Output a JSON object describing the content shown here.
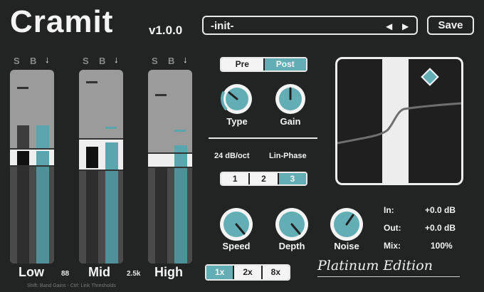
{
  "header": {
    "title": "Cramit",
    "version": "v1.0.0",
    "save_label": "Save"
  },
  "preset": {
    "name": "-init-"
  },
  "bands": {
    "solo_label": "S",
    "bypass_label": "B",
    "items": [
      {
        "label": "Low",
        "crossover": "88"
      },
      {
        "label": "Mid",
        "crossover": "2.5k"
      },
      {
        "label": "High",
        "crossover": ""
      }
    ]
  },
  "hint": "Shift: Band Gains - Ctrl: Link Thresholds",
  "mode": {
    "options": [
      "Pre",
      "Post"
    ],
    "selected": "Post"
  },
  "knobs_top": [
    {
      "label": "Type",
      "value": 0.3
    },
    {
      "label": "Gain",
      "value": 0.5
    }
  ],
  "filter": {
    "slope": "24 dB/oct",
    "phase": "Lin-Phase",
    "options": [
      "1",
      "2",
      "3"
    ],
    "selected": "3"
  },
  "knobs_bottom": [
    {
      "label": "Speed",
      "value": 0.8
    },
    {
      "label": "Depth",
      "value": 0.8
    },
    {
      "label": "Noise",
      "value": 0.6
    }
  ],
  "meters": [
    {
      "label": "In:",
      "value": "+0.0 dB"
    },
    {
      "label": "Out:",
      "value": "+0.0 dB"
    },
    {
      "label": "Mix:",
      "value": "100%"
    }
  ],
  "oversampling": {
    "options": [
      "1x",
      "2x",
      "8x"
    ],
    "selected": "1x"
  },
  "edition": "Platinum Edition",
  "colors": {
    "accent": "#63aeb5",
    "background": "#222323",
    "foreground": "#f4f4f4"
  }
}
